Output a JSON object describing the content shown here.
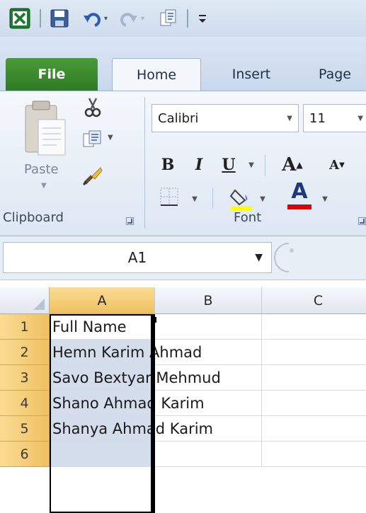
{
  "qat": {
    "app_icon": "excel-icon",
    "buttons": [
      "save-icon",
      "undo-icon",
      "redo-icon",
      "paste-special-icon",
      "customize-icon"
    ]
  },
  "tabs": [
    {
      "label": "File"
    },
    {
      "label": "Home"
    },
    {
      "label": "Insert"
    },
    {
      "label": "Page"
    }
  ],
  "ribbon": {
    "clipboard": {
      "paste_label": "Paste",
      "group_label": "Clipboard"
    },
    "font": {
      "font_name": "Calibri",
      "font_size": "11",
      "bold": "B",
      "italic": "I",
      "underline": "U",
      "grow": "A",
      "shrink": "A",
      "font_color": "A",
      "group_label": "Font"
    }
  },
  "formula_bar": {
    "name_box": "A1"
  },
  "grid": {
    "columns": [
      "A",
      "B",
      "C"
    ],
    "rows": [
      {
        "num": "1",
        "a": "Full Name"
      },
      {
        "num": "2",
        "a": "Hemn Karim Ahmad"
      },
      {
        "num": "3",
        "a": "Savo Bextyar Mehmud"
      },
      {
        "num": "4",
        "a": "Shano Ahmad Karim"
      },
      {
        "num": "5",
        "a": "Shanya Ahmad Karim"
      },
      {
        "num": "6",
        "a": ""
      }
    ]
  },
  "colors": {
    "file_tab": "#2f7a23",
    "selected_header": "#f0c060",
    "selection_fill": "#d4ddeb",
    "highlight_yellow": "#ffff00",
    "font_red": "#e00000"
  }
}
